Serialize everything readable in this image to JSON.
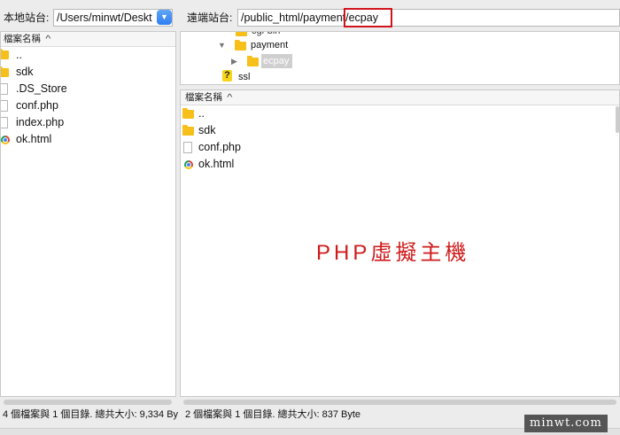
{
  "local": {
    "label": "本地站台:",
    "path": "/Users/minwt/Deskt",
    "column_header": "檔案名稱",
    "files": [
      {
        "name": "..",
        "icon": "folder-icon"
      },
      {
        "name": "sdk",
        "icon": "folder-icon"
      },
      {
        "name": ".DS_Store",
        "icon": "file-icon"
      },
      {
        "name": "conf.php",
        "icon": "file-icon"
      },
      {
        "name": "index.php",
        "icon": "file-icon"
      },
      {
        "name": "ok.html",
        "icon": "chrome-icon"
      }
    ],
    "status": "4 個檔案與 1 個目錄. 總共大小: 9,334 By"
  },
  "remote": {
    "label": "遠端站台:",
    "path": "/public_html/payment/ecpay",
    "tree": {
      "cut_item": "cgi-bin",
      "items": [
        {
          "name": "payment",
          "expanded": true
        },
        {
          "name": "ecpay",
          "selected": true
        },
        {
          "name": "ssl",
          "unknown": true
        }
      ]
    },
    "column_header": "檔案名稱",
    "files": [
      {
        "name": "..",
        "icon": "folder-icon"
      },
      {
        "name": "sdk",
        "icon": "folder-icon"
      },
      {
        "name": "conf.php",
        "icon": "file-icon"
      },
      {
        "name": "ok.html",
        "icon": "chrome-icon"
      }
    ],
    "status": "2 個檔案與 1 個目錄. 總共大小: 837 Byte"
  },
  "overlay": {
    "title": "PHP虛擬主機",
    "color": "#cf1b1b"
  },
  "watermark": "minwt.com",
  "colors": {
    "folder": "#f7bf19",
    "highlight": "#d0141b",
    "dropdown": "#2f7ef0"
  }
}
